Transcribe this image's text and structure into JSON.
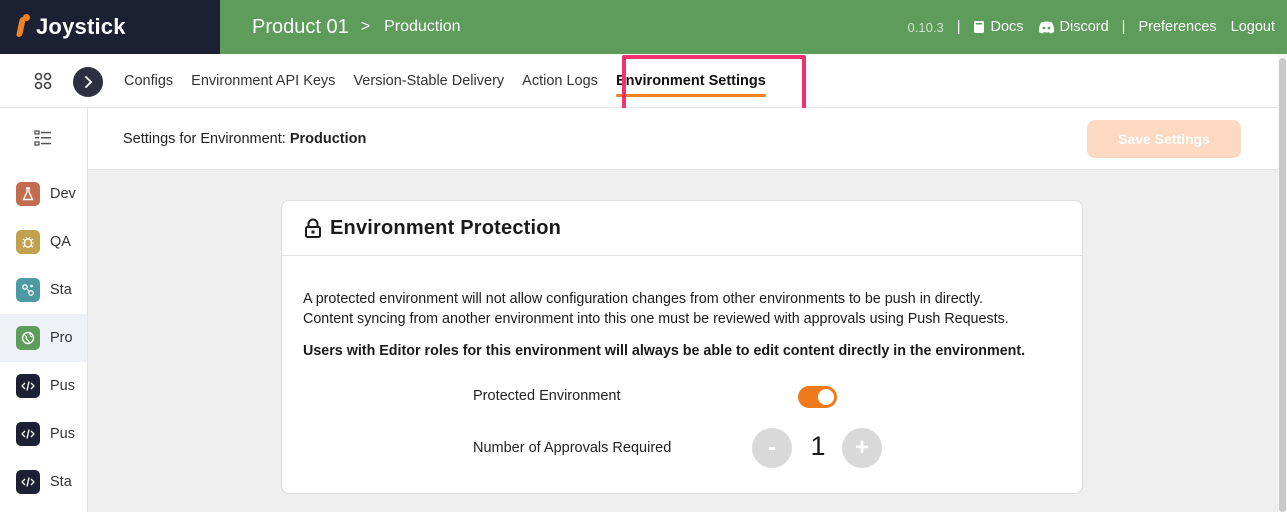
{
  "app": {
    "name": "Joystick"
  },
  "breadcrumb": {
    "product": "Product 01",
    "separator": ">",
    "environment": "Production"
  },
  "topbar": {
    "version": "0.10.3",
    "docs": "Docs",
    "discord": "Discord",
    "preferences": "Preferences",
    "logout": "Logout",
    "pipe": "|"
  },
  "tabs": [
    "Configs",
    "Environment API Keys",
    "Version-Stable Delivery",
    "Action Logs",
    "Environment Settings"
  ],
  "active_tab": "Environment Settings",
  "sidebar": {
    "environments": [
      {
        "label": "Dev",
        "icon": "flask-icon",
        "color": "#c26d50"
      },
      {
        "label": "QA",
        "icon": "bug-icon",
        "color": "#c2a24f"
      },
      {
        "label": "Sta",
        "icon": "nodes-icon",
        "color": "#4e9aa3"
      },
      {
        "label": "Pro",
        "icon": "globe-icon",
        "color": "#5d9c5a"
      },
      {
        "label": "Pus",
        "icon": "code-icon",
        "color": "#1b2033"
      },
      {
        "label": "Pus",
        "icon": "code-icon",
        "color": "#1b2033"
      },
      {
        "label": "Sta",
        "icon": "code-icon",
        "color": "#1b2033"
      }
    ]
  },
  "settings": {
    "prefix": "Settings for Environment:",
    "environment": "Production",
    "save_label": "Save Settings"
  },
  "protection": {
    "title": "Environment Protection",
    "description_line1": "A protected environment will not allow configuration changes from other environments to be push in directly.",
    "description_line2": "Content syncing from another environment into this one must be reviewed with approvals using Push Requests.",
    "warning": "Users with Editor roles for this environment will always be able to edit content directly in the environment.",
    "protected_label": "Protected Environment",
    "protected_on": true,
    "approvals_label": "Number of Approvals Required",
    "approvals_value": "1",
    "minus_label": "-",
    "plus_label": "+"
  },
  "colors": {
    "brand_green": "#5d9c5a",
    "dark_navy": "#1b2033",
    "accent_orange": "#f08224",
    "highlight_pink": "#f0336f"
  }
}
